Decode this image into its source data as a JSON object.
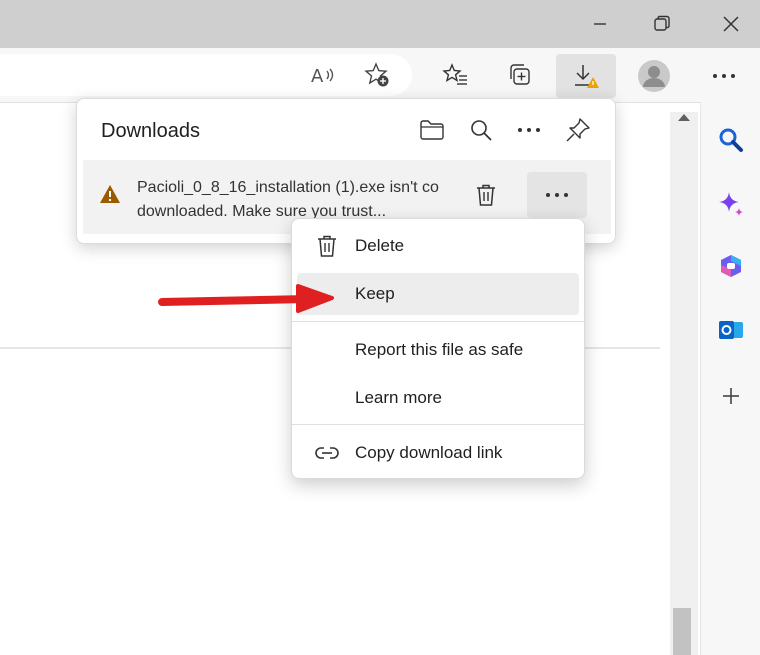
{
  "downloads": {
    "title": "Downloads",
    "item": {
      "line1": "Pacioli_0_8_16_installation (1).exe isn't co",
      "line2": "downloaded. Make sure you trust..."
    }
  },
  "menu": {
    "items": [
      {
        "label": "Delete",
        "icon": "trash-icon"
      },
      {
        "label": "Keep",
        "icon": "none"
      },
      {
        "label": "Report this file as safe",
        "icon": "none"
      },
      {
        "label": "Learn more",
        "icon": "none"
      },
      {
        "label": "Copy download link",
        "icon": "link-icon"
      }
    ]
  },
  "colors": {
    "warning": "#9a5b00",
    "arrow": "#e02020",
    "search_blue": "#1a64d8",
    "copilot_purple": "#7b3ff2",
    "outlook_blue": "#0a64c8"
  }
}
